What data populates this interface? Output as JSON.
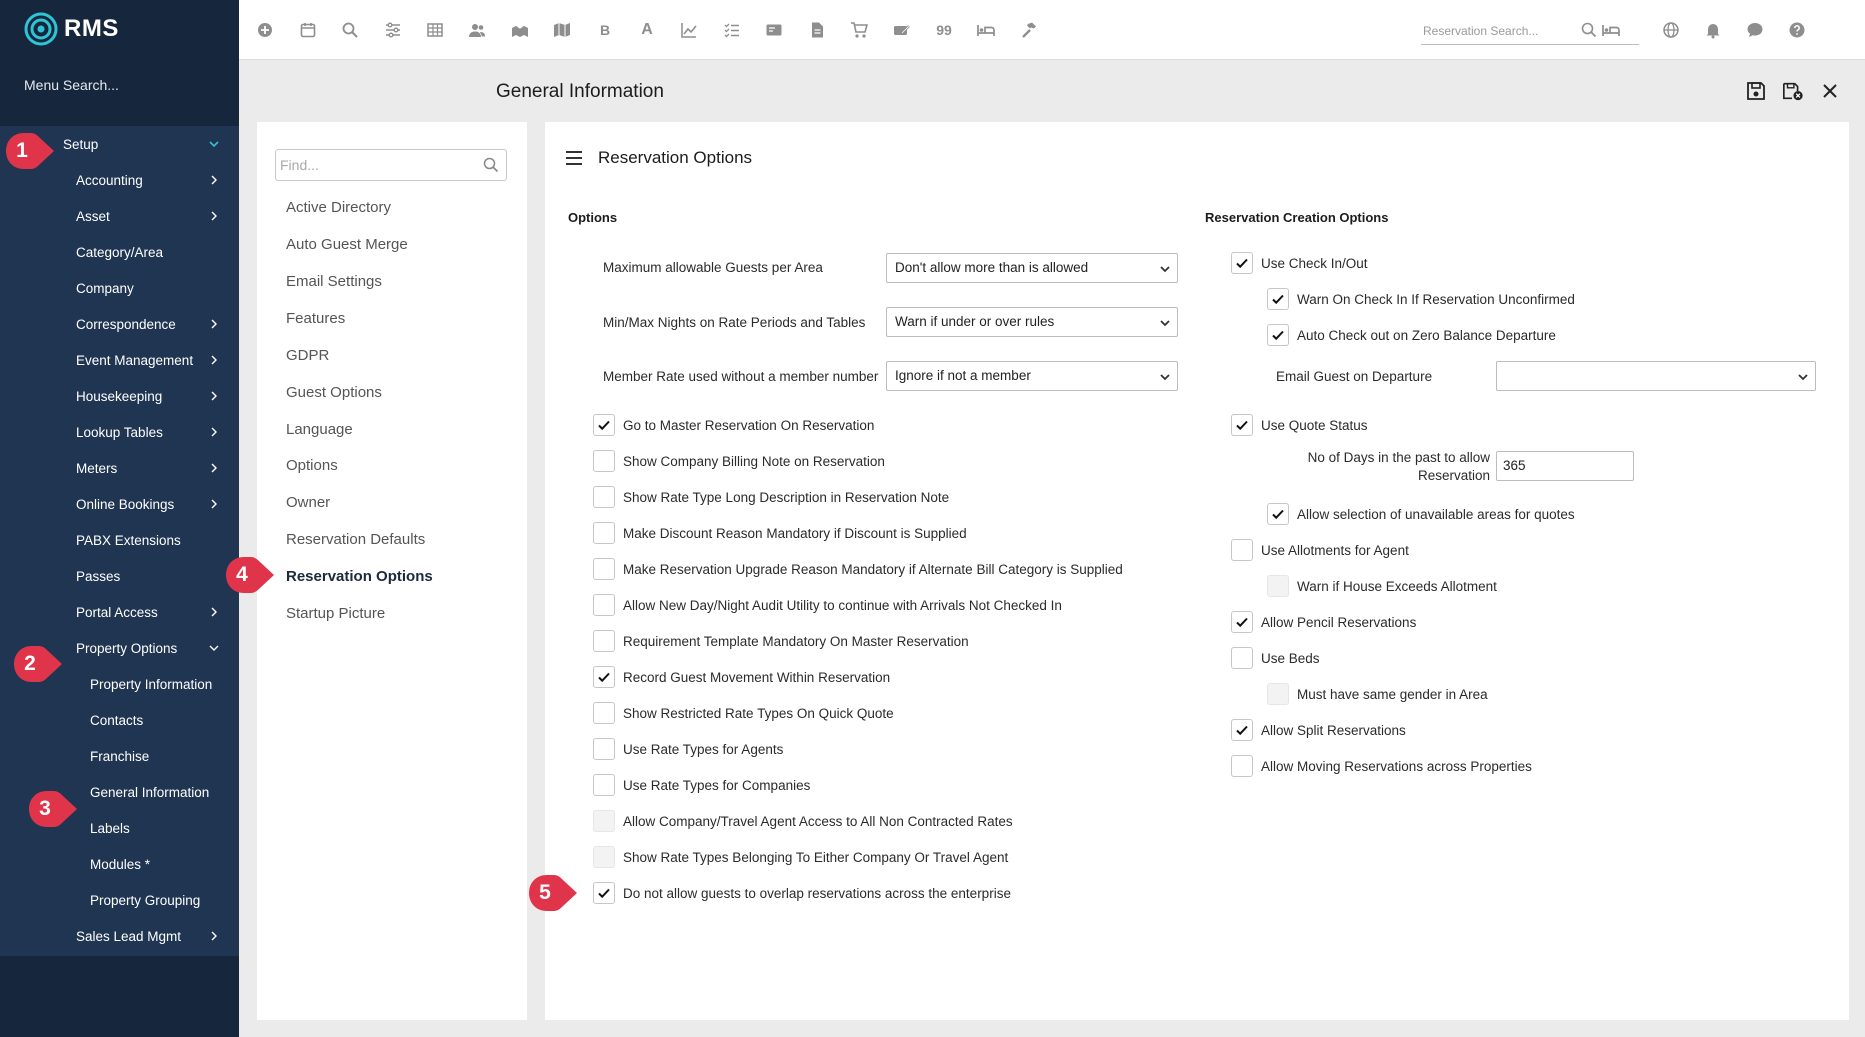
{
  "app": {
    "logo_text": "RMS",
    "menu_search": "Menu Search..."
  },
  "colors": {
    "sidebar_bg": "#16273d",
    "menu_bg": "#1f3551",
    "marker": "#e0344b",
    "check": "#111111"
  },
  "sidebar": {
    "items": [
      {
        "label": "Setup",
        "chevron": "down"
      },
      {
        "label": "Accounting",
        "chevron": "right"
      },
      {
        "label": "Asset",
        "chevron": "right"
      },
      {
        "label": "Category/Area",
        "chevron": ""
      },
      {
        "label": "Company",
        "chevron": ""
      },
      {
        "label": "Correspondence",
        "chevron": "right"
      },
      {
        "label": "Event Management",
        "chevron": "right"
      },
      {
        "label": "Housekeeping",
        "chevron": "right"
      },
      {
        "label": "Lookup Tables",
        "chevron": "right"
      },
      {
        "label": "Meters",
        "chevron": "right"
      },
      {
        "label": "Online Bookings",
        "chevron": "right"
      },
      {
        "label": "PABX Extensions",
        "chevron": ""
      },
      {
        "label": "Passes",
        "chevron": ""
      },
      {
        "label": "Portal Access",
        "chevron": "right"
      },
      {
        "label": "Property Options",
        "chevron": "down"
      },
      {
        "label": "Property Information",
        "chevron": ""
      },
      {
        "label": "Contacts",
        "chevron": ""
      },
      {
        "label": "Franchise",
        "chevron": ""
      },
      {
        "label": "General Information",
        "chevron": ""
      },
      {
        "label": "Labels",
        "chevron": ""
      },
      {
        "label": "Modules *",
        "chevron": ""
      },
      {
        "label": "Property Grouping",
        "chevron": ""
      },
      {
        "label": "Sales Lead Mgmt",
        "chevron": "right"
      }
    ]
  },
  "toolbar": {
    "icons": [
      "add-circle-icon",
      "calendar-icon",
      "search-icon",
      "sliders-icon",
      "grid-icon",
      "users-icon",
      "map-pins-icon",
      "map-icon",
      "bold-b-icon",
      "letter-a-icon",
      "line-chart-icon",
      "checklist-icon",
      "id-card-icon",
      "document-icon",
      "cart-icon",
      "ticket-edit-icon",
      "quote-icon",
      "bed-icon",
      "hammer-icon"
    ],
    "b_letter": "B",
    "a_letter": "A",
    "quote_glyph": "99",
    "reservation_search_placeholder": "Reservation Search...",
    "right_icons": [
      "globe-icon",
      "bell-icon",
      "chat-icon",
      "help-icon"
    ]
  },
  "page": {
    "title": "General Information"
  },
  "left_panel": {
    "find_placeholder": "Find...",
    "items": [
      "Active Directory",
      "Auto Guest Merge",
      "Email Settings",
      "Features",
      "GDPR",
      "Guest Options",
      "Language",
      "Options",
      "Owner",
      "Reservation Defaults",
      "Reservation Options",
      "Startup Picture"
    ],
    "active_index": 10
  },
  "main": {
    "title": "Reservation Options",
    "options": {
      "heading": "Options",
      "selects": [
        {
          "label": "Maximum allowable Guests per Area",
          "value": "Don't allow more than is allowed"
        },
        {
          "label": "Min/Max Nights on Rate Periods and Tables",
          "value": "Warn if under or over rules"
        },
        {
          "label": "Member Rate used without a member number",
          "value": "Ignore if not a member"
        }
      ],
      "checkboxes": [
        {
          "label": "Go to Master Reservation On Reservation",
          "checked": true,
          "disabled": false
        },
        {
          "label": "Show Company Billing Note on Reservation",
          "checked": false,
          "disabled": false
        },
        {
          "label": "Show Rate Type Long Description in Reservation Note",
          "checked": false,
          "disabled": false
        },
        {
          "label": "Make Discount Reason Mandatory if Discount is Supplied",
          "checked": false,
          "disabled": false
        },
        {
          "label": "Make Reservation Upgrade Reason Mandatory if Alternate Bill Category is Supplied",
          "checked": false,
          "disabled": false
        },
        {
          "label": "Allow New Day/Night Audit Utility to continue with Arrivals Not Checked In",
          "checked": false,
          "disabled": false
        },
        {
          "label": "Requirement Template Mandatory On Master Reservation",
          "checked": false,
          "disabled": false
        },
        {
          "label": "Record Guest Movement Within Reservation",
          "checked": true,
          "disabled": false
        },
        {
          "label": "Show Restricted Rate Types On Quick Quote",
          "checked": false,
          "disabled": false
        },
        {
          "label": "Use Rate Types for Agents",
          "checked": false,
          "disabled": false
        },
        {
          "label": "Use Rate Types for Companies",
          "checked": false,
          "disabled": false
        },
        {
          "label": "Allow Company/Travel Agent Access to All Non Contracted Rates",
          "checked": false,
          "disabled": true
        },
        {
          "label": "Show Rate Types Belonging To Either Company Or Travel Agent",
          "checked": false,
          "disabled": true
        },
        {
          "label": "Do not allow guests to overlap reservations across the enterprise",
          "checked": true,
          "disabled": false
        }
      ]
    },
    "creation": {
      "heading": "Reservation Creation Options",
      "use_check_in_out": {
        "label": "Use Check In/Out",
        "checked": true
      },
      "warn_check_in": {
        "label": "Warn On Check In If Reservation Unconfirmed",
        "checked": true
      },
      "auto_check_out": {
        "label": "Auto Check out on Zero Balance Departure",
        "checked": true
      },
      "email_guest": {
        "label": "Email Guest on Departure",
        "value": ""
      },
      "use_quote_status": {
        "label": "Use Quote Status",
        "checked": true
      },
      "days_past": {
        "label_line1": "No of Days in the past to allow",
        "label_line2": "Reservation",
        "value": "365"
      },
      "allow_unavailable": {
        "label": "Allow selection of unavailable areas for quotes",
        "checked": true
      },
      "use_allotments": {
        "label": "Use Allotments for Agent",
        "checked": false
      },
      "warn_house": {
        "label": "Warn if House Exceeds Allotment",
        "checked": false,
        "disabled": true
      },
      "allow_pencil": {
        "label": "Allow Pencil Reservations",
        "checked": true
      },
      "use_beds": {
        "label": "Use Beds",
        "checked": false
      },
      "same_gender": {
        "label": "Must have same gender in Area",
        "checked": false,
        "disabled": true
      },
      "allow_split": {
        "label": "Allow Split Reservations",
        "checked": true
      },
      "allow_moving": {
        "label": "Allow Moving Reservations across Properties",
        "checked": false
      }
    }
  },
  "markers": [
    "1",
    "2",
    "3",
    "4",
    "5"
  ]
}
